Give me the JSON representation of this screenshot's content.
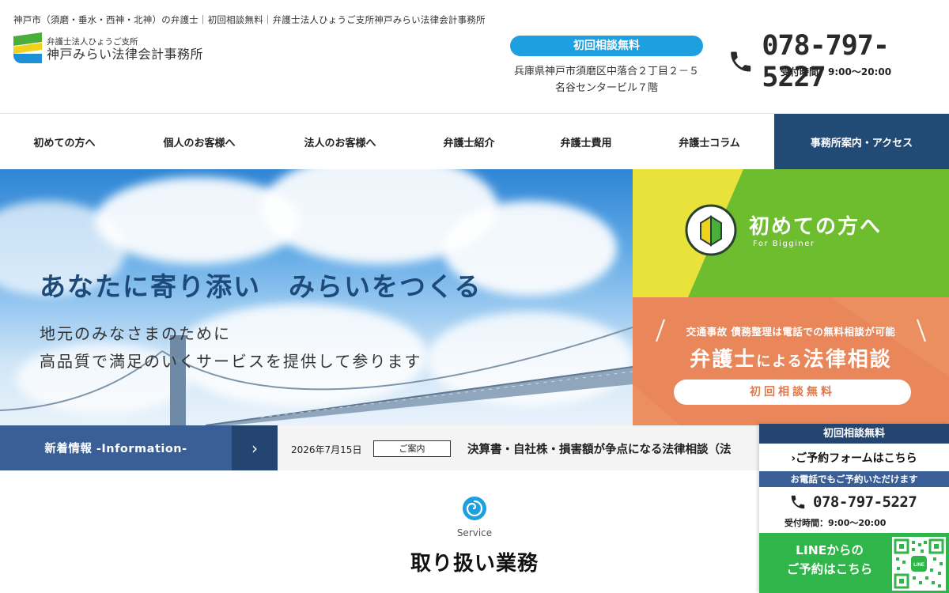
{
  "header": {
    "tagline": "神戸市（須磨・垂水・西神・北神）の弁護士｜初回相談無料｜弁護士法人ひょうご支所神戸みらい法律会計事務所",
    "logo_sub": "弁護士法人ひょうご支所",
    "logo_main": "神戸みらい法律会計事務所",
    "consult_pill": "初回相談無料",
    "address_line1": "兵庫県神戸市須磨区中落合２丁目２－５",
    "address_line2": "名谷センタービル７階",
    "phone_number": "078-797-5227",
    "phone_hours": "受付時間：9:00〜20:00"
  },
  "nav": {
    "items": [
      {
        "label": "初めての方へ"
      },
      {
        "label": "個人のお客様へ"
      },
      {
        "label": "法人のお客様へ"
      },
      {
        "label": "弁護士紹介"
      },
      {
        "label": "弁護士費用"
      },
      {
        "label": "弁護士コラム"
      },
      {
        "label": "事務所案内・アクセス"
      }
    ]
  },
  "hero": {
    "title": "あなたに寄り添い　みらいをつくる",
    "line1": "地元のみなさまのために",
    "line2": "高品質で満足のいくサービスを提供して参ります"
  },
  "panels": {
    "first_title": "初めての方へ",
    "first_sub": "For Bigginer",
    "lawyer_top": "交通事故 債務整理は電話での無料相談が可能",
    "lawyer_main_1": "弁護士",
    "lawyer_main_2": "による",
    "lawyer_main_3": "法律相談",
    "lawyer_button": "初回相談無料"
  },
  "info": {
    "label": "新着情報 -Information-",
    "arrow": "›",
    "date": "2026年7月15日",
    "tag": "ご案内",
    "title": "決算書・自社株・損害額が争点になる法律相談（法"
  },
  "service": {
    "en": "Service",
    "title": "取り扱い業務"
  },
  "floating": {
    "head": "初回相談無料",
    "form_link": "ご予約フォームはこちら",
    "form_chevron": "›",
    "tel_head": "お電話でもご予約いただけます",
    "tel_number": "078-797-5227",
    "tel_hours": "受付時間：9:00〜20:00",
    "line_text_1": "LINEからの",
    "line_text_2": "ご予約はこちら",
    "qr_label": "LINE"
  },
  "colors": {
    "navy": "#214a75",
    "blue_accent": "#1ea0e0",
    "green": "#6ebd2f",
    "yellow": "#e9e23a",
    "orange": "#e9875a",
    "line_green": "#2fb54a"
  }
}
